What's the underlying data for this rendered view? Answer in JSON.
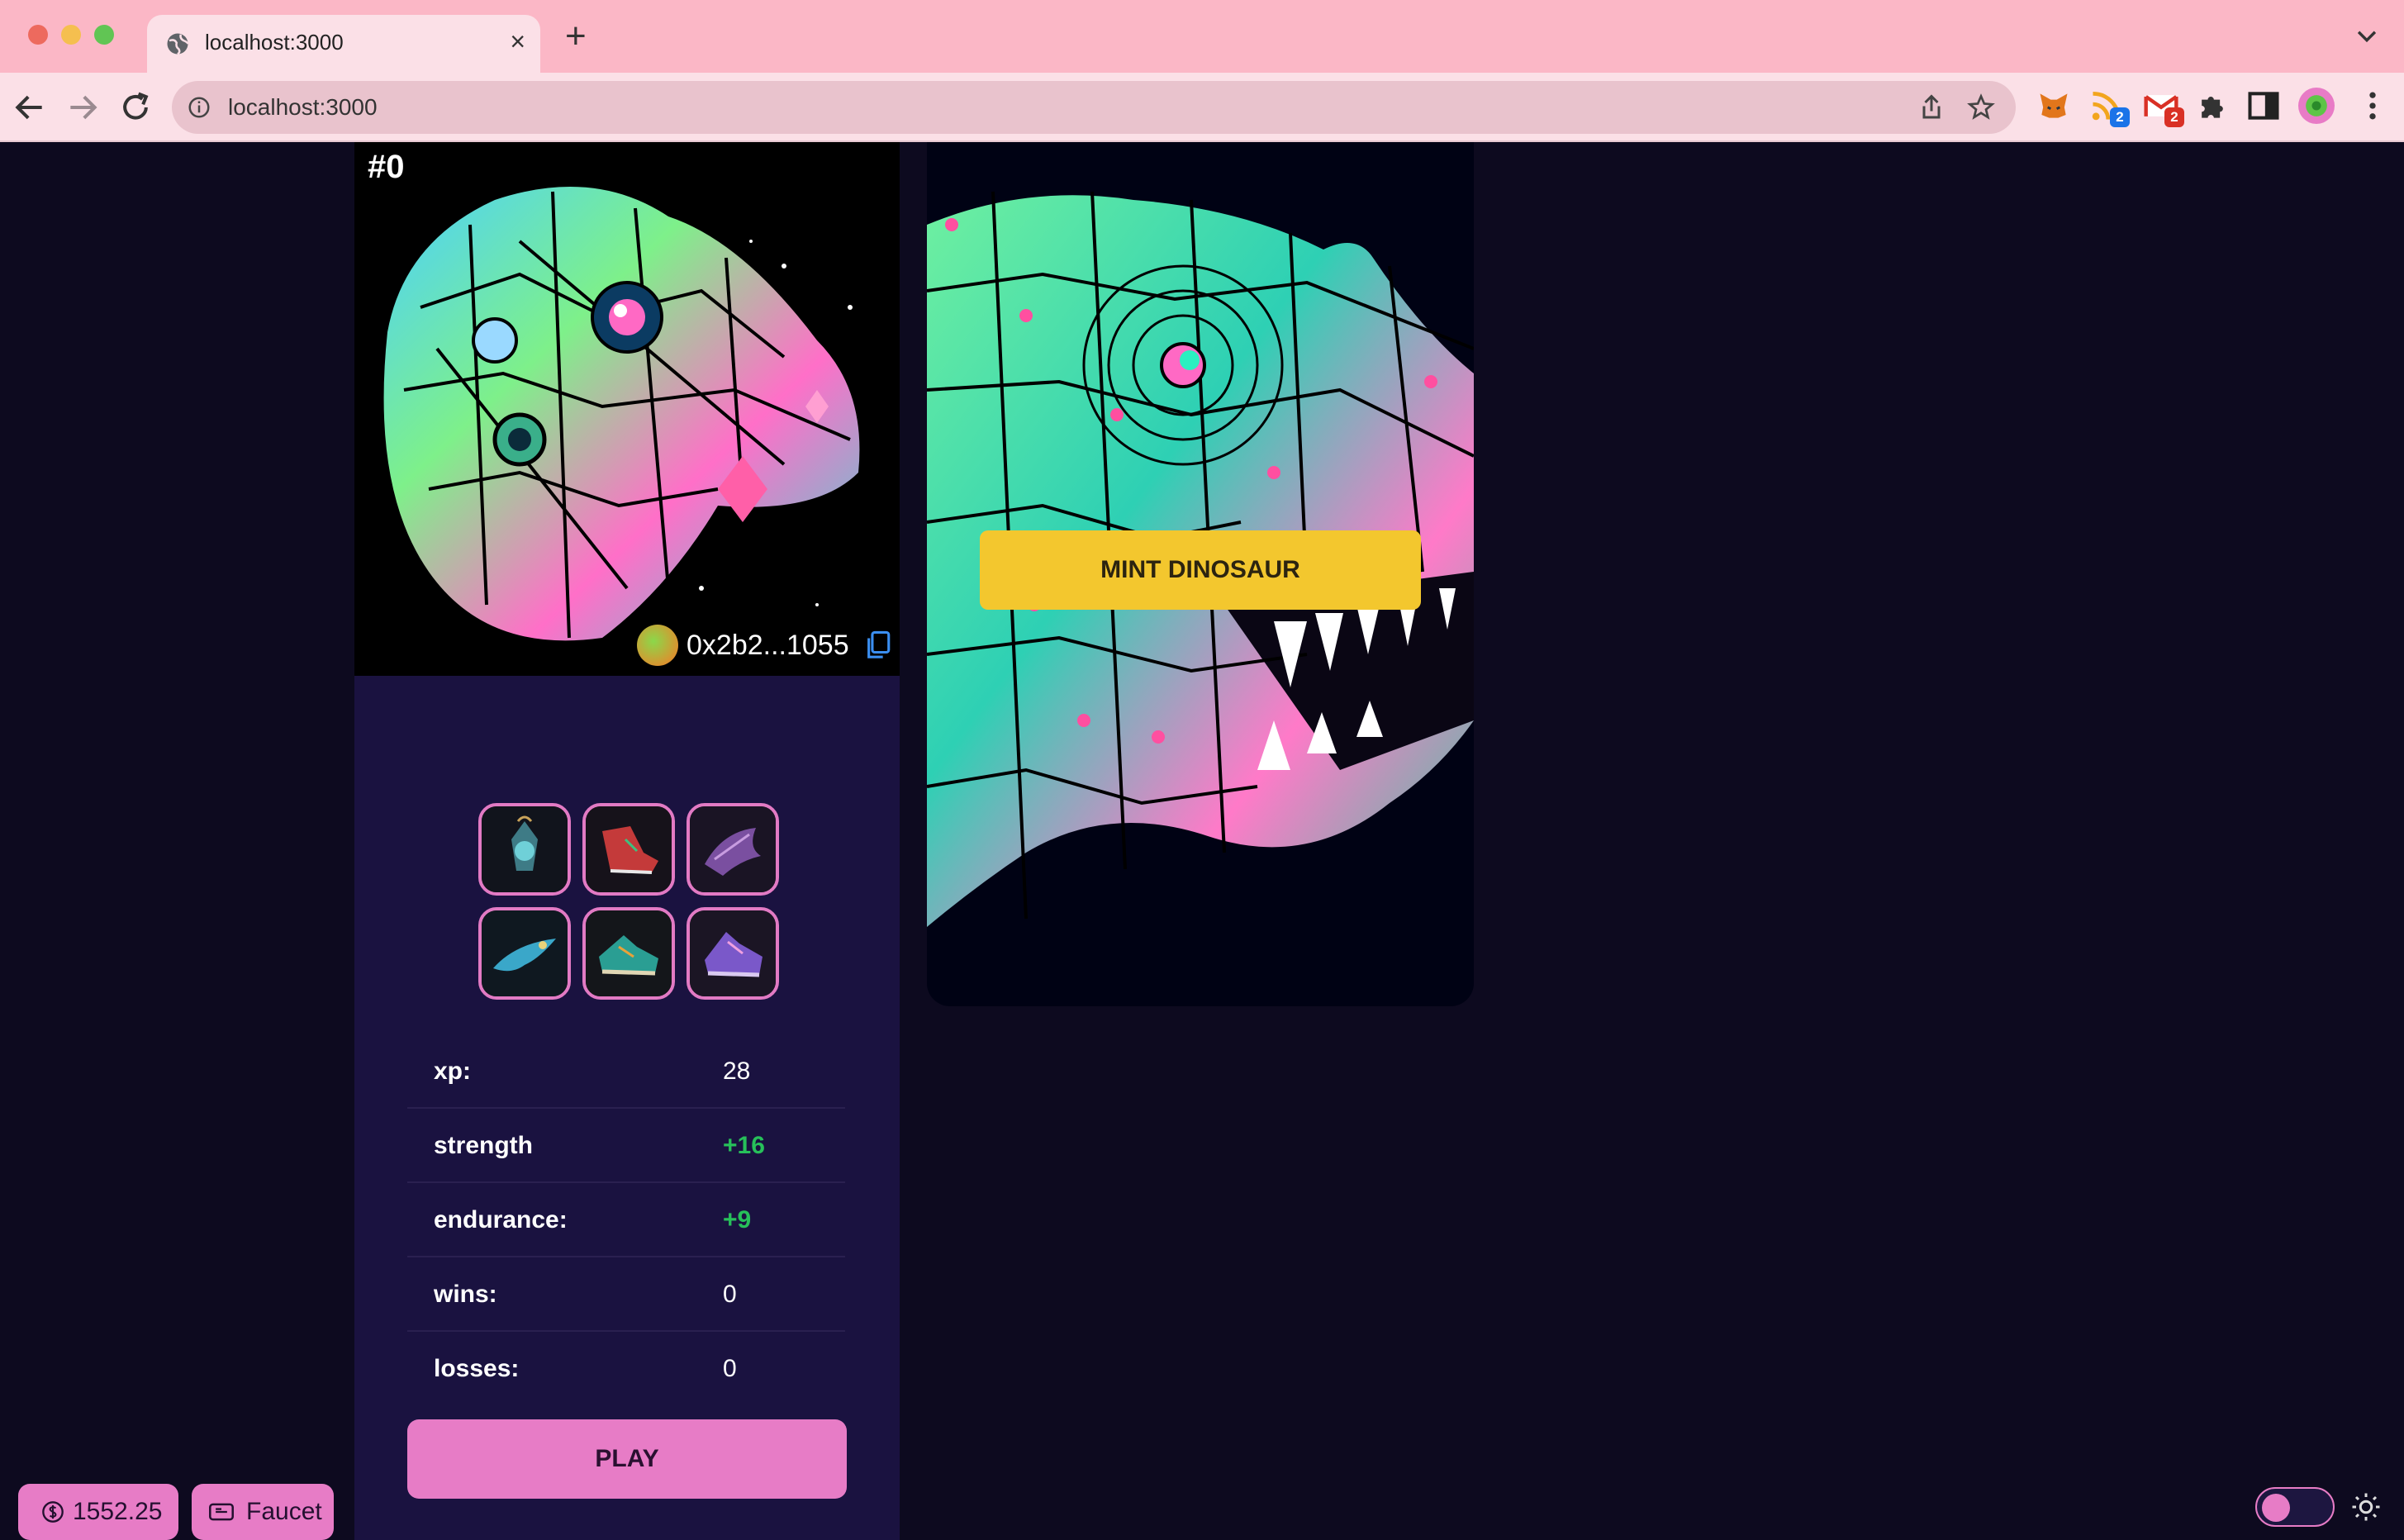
{
  "browser": {
    "tab_title": "localhost:3000",
    "url": "localhost:3000",
    "extensions": [
      {
        "name": "metamask-icon"
      },
      {
        "name": "rss-icon",
        "badge": "2",
        "badge_color": "#1a73e8"
      },
      {
        "name": "gmail-icon",
        "badge": "2",
        "badge_color": "#d93025"
      },
      {
        "name": "puzzle-icon"
      },
      {
        "name": "sidepanel-icon"
      },
      {
        "name": "profile-avatar"
      },
      {
        "name": "kebab-menu-icon"
      }
    ]
  },
  "dino": {
    "token_id": "#0",
    "owner_address": "0x2b2...1055"
  },
  "items": [
    {
      "name": "amulet"
    },
    {
      "name": "boots-red"
    },
    {
      "name": "claw-purple"
    },
    {
      "name": "dragon-blue"
    },
    {
      "name": "sneakers-teal"
    },
    {
      "name": "sneakers-purple"
    }
  ],
  "stats": [
    {
      "label": "xp:",
      "value": "28",
      "positive": false
    },
    {
      "label": "strength",
      "value": "+16",
      "positive": true
    },
    {
      "label": "endurance:",
      "value": "+9",
      "positive": true
    },
    {
      "label": "wins:",
      "value": "0",
      "positive": false
    },
    {
      "label": "losses:",
      "value": "0",
      "positive": false
    }
  ],
  "actions": {
    "play_label": "PLAY",
    "mint_label": "MINT DINOSAUR"
  },
  "wallet": {
    "balance": "1552.25",
    "faucet_label": "Faucet"
  },
  "colors": {
    "accent_pink": "#e77cc6",
    "mint_yellow": "#f3c72e",
    "positive_green": "#27c05a",
    "panel_bg": "#1a1240",
    "page_bg": "#0d0a1f"
  }
}
